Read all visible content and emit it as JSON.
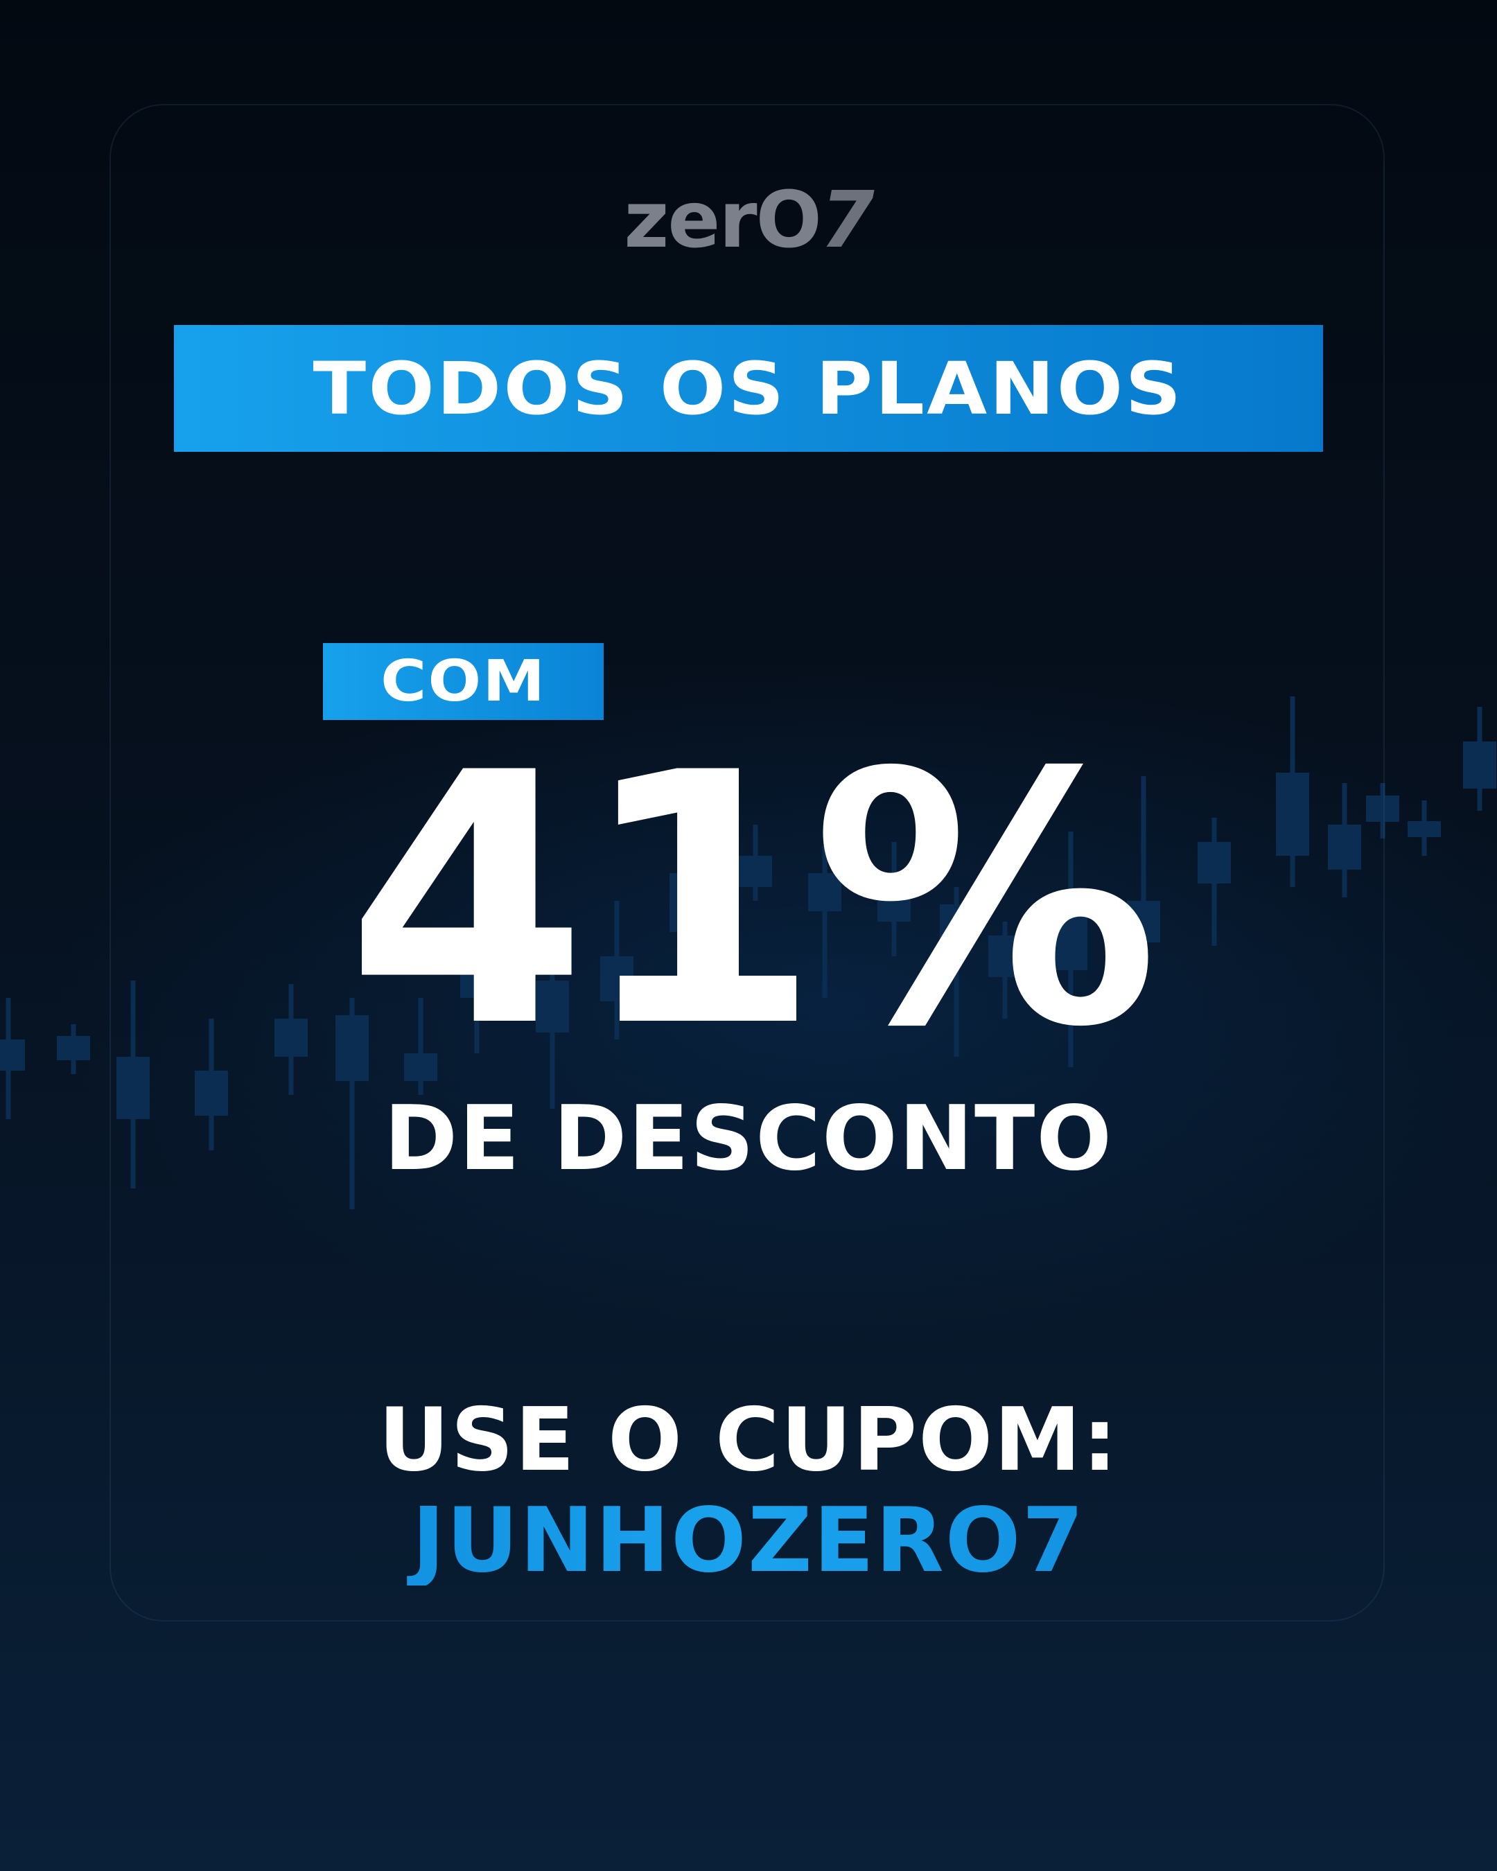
{
  "logo": {
    "text_main": "zerO",
    "text_seven": "7"
  },
  "banner": {
    "label": "TODOS OS PLANOS"
  },
  "offer": {
    "prefix": "COM",
    "percent": "41%",
    "suffix": "DE DESCONTO"
  },
  "coupon": {
    "label": "USE O CUPOM:",
    "code": "JUNHOZERO7"
  },
  "colors": {
    "accent": "#1593e0",
    "background": "#050d18",
    "text": "#ffffff",
    "logo": "#7c808a"
  },
  "decor": {
    "background_icon": "candlestick-chart-icon"
  }
}
